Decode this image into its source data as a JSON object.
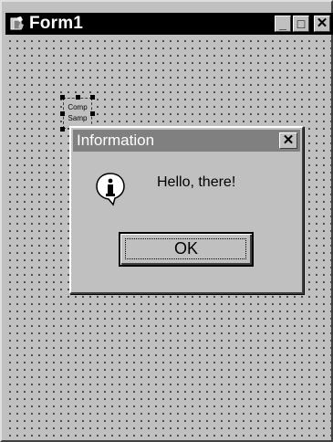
{
  "form": {
    "title": "Form1",
    "icon": "app-icon",
    "buttons": {
      "minimize_icon": "minimize-icon",
      "maximize_icon": "maximize-icon",
      "close_icon": "close-icon"
    }
  },
  "component": {
    "line1": "Comp",
    "line2": "Samp"
  },
  "dialog": {
    "title": "Information",
    "close_icon": "close-icon",
    "icon": "information-icon",
    "message": "Hello, there!",
    "ok_label": "OK"
  },
  "colors": {
    "form_background": "#c0c0c0",
    "titlebar_active": "#000000",
    "titlebar_inactive": "#808080",
    "text": "#000000"
  }
}
